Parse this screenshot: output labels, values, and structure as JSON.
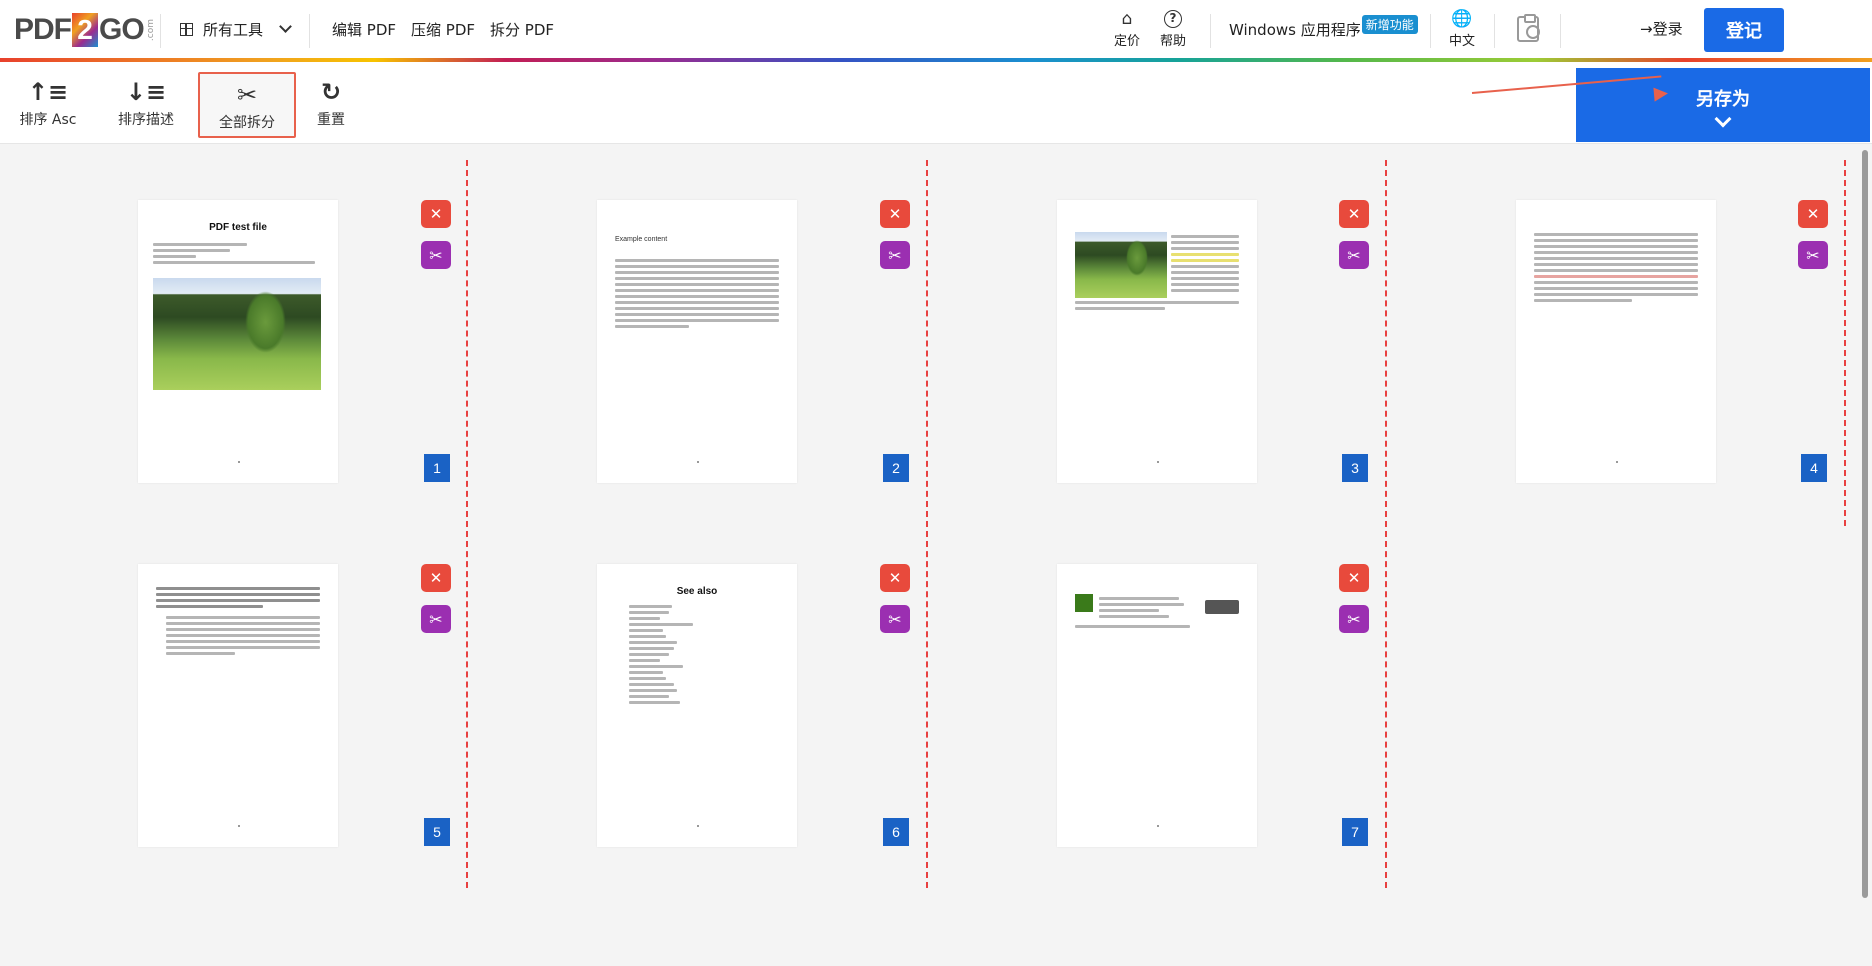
{
  "header": {
    "logo_left": "PDF",
    "logo_two": "2",
    "logo_right": "GO",
    "logo_com": ".com",
    "all_tools": "所有工具",
    "nav_links": [
      "编辑 PDF",
      "压缩 PDF",
      "拆分 PDF"
    ],
    "pricing": "定价",
    "help": "帮助",
    "windows_app": "Windows 应用程序",
    "new_badge": "新增功能",
    "language": "中文",
    "login": "登录",
    "signup": "登记"
  },
  "toolbar": {
    "sort_asc": "排序 Asc",
    "sort_desc": "排序描述",
    "split_all": "全部拆分",
    "reset": "重置",
    "save_as": "另存为"
  },
  "pages": [
    {
      "number": "1",
      "title": "PDF test file"
    },
    {
      "number": "2",
      "heading": "Example content"
    },
    {
      "number": "3"
    },
    {
      "number": "4"
    },
    {
      "number": "5"
    },
    {
      "number": "6",
      "title": "See also"
    },
    {
      "number": "7"
    }
  ],
  "icons": {
    "delete": "close-icon",
    "split": "scissors-icon"
  },
  "colors": {
    "primary": "#1a6ae6",
    "delete": "#e84a3c",
    "split": "#9b2fb1",
    "split_line": "#e84040",
    "page_number": "#1a62c5"
  }
}
